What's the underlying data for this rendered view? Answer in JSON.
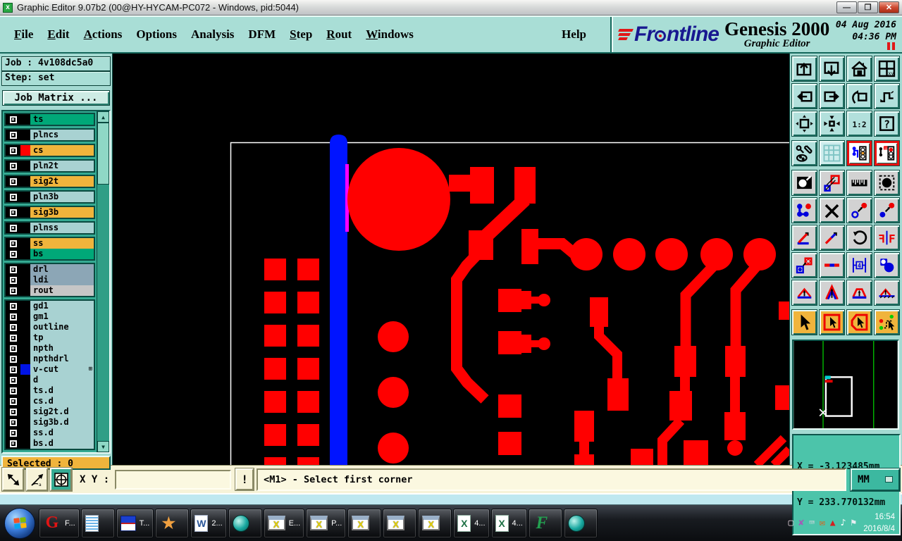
{
  "window": {
    "title": "Graphic Editor 9.07b2 (00@HY-HYCAM-PC072 - Windows, pid:5044)",
    "controls": [
      "minimize",
      "restore",
      "close"
    ]
  },
  "header": {
    "menus": [
      {
        "label": "File",
        "u": 0
      },
      {
        "label": "Edit",
        "u": 0
      },
      {
        "label": "Actions",
        "u": 0
      },
      {
        "label": "Options",
        "u": -1
      },
      {
        "label": "Analysis",
        "u": -1
      },
      {
        "label": "DFM",
        "u": -1
      },
      {
        "label": "Step",
        "u": 0
      },
      {
        "label": "Rout",
        "u": 0
      },
      {
        "label": "Windows",
        "u": 0
      }
    ],
    "help_label": "Help",
    "brand": {
      "name_prefix": "Fr",
      "name_suffix": "ntline",
      "product": "Genesis 2000",
      "subtitle": "Graphic Editor",
      "date": "04 Aug 2016",
      "time": "04:36 PM"
    }
  },
  "job_panel": {
    "job_line": "Job : 4v108dc5a0",
    "step_line": "Step: set",
    "matrix_button": "Job Matrix ...",
    "selected_label": "Selected : 0"
  },
  "layers": {
    "rows": [
      {
        "label": "ts",
        "bg": "green",
        "swatch": "black",
        "g": 1
      },
      {
        "label": "plncs",
        "bg": "cyan",
        "swatch": "black",
        "g": 2
      },
      {
        "label": "cs",
        "bg": "orange",
        "swatch": "red",
        "g": 3
      },
      {
        "label": "pln2t",
        "bg": "cyan",
        "swatch": "black",
        "g": 4
      },
      {
        "label": "sig2t",
        "bg": "orange",
        "swatch": "black",
        "g": 5
      },
      {
        "label": "pln3b",
        "bg": "cyan",
        "swatch": "black",
        "g": 6
      },
      {
        "label": "sig3b",
        "bg": "orange",
        "swatch": "black",
        "g": 7
      },
      {
        "label": "plnss",
        "bg": "cyan",
        "swatch": "black",
        "g": 8
      },
      {
        "label": "ss",
        "bg": "orange",
        "swatch": "black",
        "g": 9
      },
      {
        "label": "bs",
        "bg": "green",
        "swatch": "black",
        "g": 9
      },
      {
        "label": "drl",
        "bg": "slate",
        "swatch": "black",
        "g": 10
      },
      {
        "label": "ldi",
        "bg": "slate",
        "swatch": "black",
        "g": 10
      },
      {
        "label": "rout",
        "bg": "gray",
        "swatch": "black",
        "g": 10
      },
      {
        "label": "gd1",
        "bg": "cyan",
        "swatch": "black",
        "g": 11
      },
      {
        "label": "gm1",
        "bg": "cyan",
        "swatch": "black",
        "g": 11
      },
      {
        "label": "outline",
        "bg": "cyan",
        "swatch": "black",
        "g": 11
      },
      {
        "label": "tp",
        "bg": "cyan",
        "swatch": "black",
        "g": 11
      },
      {
        "label": "npth",
        "bg": "cyan",
        "swatch": "black",
        "g": 11
      },
      {
        "label": "npthdrl",
        "bg": "cyan",
        "swatch": "black",
        "g": 11
      },
      {
        "label": "v-cut",
        "bg": "cyan",
        "swatch": "blue",
        "g": 11,
        "marker": true
      },
      {
        "label": "d",
        "bg": "cyan",
        "swatch": "black",
        "g": 11
      },
      {
        "label": "ts.d",
        "bg": "cyan",
        "swatch": "black",
        "g": 11
      },
      {
        "label": "cs.d",
        "bg": "cyan",
        "swatch": "black",
        "g": 11
      },
      {
        "label": "sig2t.d",
        "bg": "cyan",
        "swatch": "black",
        "g": 11
      },
      {
        "label": "sig3b.d",
        "bg": "cyan",
        "swatch": "black",
        "g": 11
      },
      {
        "label": "ss.d",
        "bg": "cyan",
        "swatch": "black",
        "g": 11
      },
      {
        "label": "bs.d",
        "bg": "cyan",
        "swatch": "black",
        "g": 11
      }
    ]
  },
  "right_toolbar": {
    "icons": [
      "zoom-fit",
      "zoom-out-view",
      "home-view",
      "split-window-xy",
      "pan-left",
      "pan-right",
      "previous-view",
      "route-path",
      "zoom-out",
      "zoom-in",
      "zoom-ratio",
      "help",
      "setup-tools",
      "snap-grid",
      "layer-display-a",
      "layer-display-b",
      "film-view",
      "shape-edit",
      "measure-ruler",
      "pad-symbol",
      "net-highlight",
      "net-clear",
      "move-open",
      "move-copy",
      "measure-angle",
      "measure-line",
      "rotate",
      "mirror",
      "swap-symbols",
      "line-segments",
      "spacing-measure",
      "copy-shapes",
      "arc-fill-a",
      "arc-fill-b",
      "arc-fill-c",
      "arc-fill-d",
      "select-arrow",
      "select-rectangle",
      "select-polygon",
      "select-net"
    ],
    "zoom_ratio_label": "1:2",
    "help_label": "?",
    "mirror_letter": "F",
    "spacing_number": "4"
  },
  "overview": {
    "x_readout": "X = -3.123485mm",
    "y_readout": "Y = 233.770132mm"
  },
  "statusbar": {
    "xy_label": "X Y :",
    "input_value": "",
    "exclaim_label": "!",
    "prompt": "<M1> - Select first corner",
    "units": "MM"
  },
  "canvas": {
    "colors": {
      "background": "#000000",
      "trace": "#ff0000",
      "vcut_line": "#0014ff",
      "profile_outline": "#ffffff",
      "highlight": "#ff00ff"
    }
  },
  "taskbar": {
    "buttons": [
      {
        "icon": "genesis-g",
        "glyph": "G",
        "label": "F..."
      },
      {
        "icon": "notepad",
        "glyph": ""
      },
      {
        "icon": "floppy",
        "glyph": "",
        "label": "T..."
      },
      {
        "icon": "shell",
        "glyph": "★"
      },
      {
        "icon": "word",
        "glyph": "W",
        "label": "2..."
      },
      {
        "icon": "orb-app",
        "glyph": ""
      },
      {
        "icon": "xterm",
        "glyph": "X",
        "label": "E..."
      },
      {
        "icon": "xterm",
        "glyph": "X",
        "label": "P..."
      },
      {
        "icon": "xterm",
        "glyph": "X"
      },
      {
        "icon": "xterm",
        "glyph": "X"
      },
      {
        "icon": "xterm",
        "glyph": "X"
      },
      {
        "icon": "excel",
        "glyph": "X",
        "label": "4..."
      },
      {
        "icon": "excel",
        "glyph": "X",
        "label": "4..."
      },
      {
        "icon": "frontline-f",
        "glyph": "F"
      },
      {
        "icon": "orb-app",
        "glyph": ""
      }
    ],
    "tray": [
      {
        "name": "tray-app-icon",
        "glyph": "▢",
        "color": "#e8d8e0"
      },
      {
        "name": "tray-purple-x-icon",
        "glyph": "✘",
        "color": "#a45ab8"
      },
      {
        "name": "tray-display-icon",
        "glyph": "⌨",
        "color": "#cfd6dd"
      },
      {
        "name": "tray-mail-icon",
        "glyph": "✉",
        "color": "#e85a10"
      },
      {
        "name": "tray-alert-icon",
        "glyph": "▲",
        "color": "#d42020"
      },
      {
        "name": "tray-volume-icon",
        "glyph": "♪",
        "color": "#ffffff"
      },
      {
        "name": "tray-network-icon",
        "glyph": "⚑",
        "color": "#e8eef2"
      }
    ],
    "clock_time": "16:54",
    "clock_date": "2016/8/4"
  }
}
